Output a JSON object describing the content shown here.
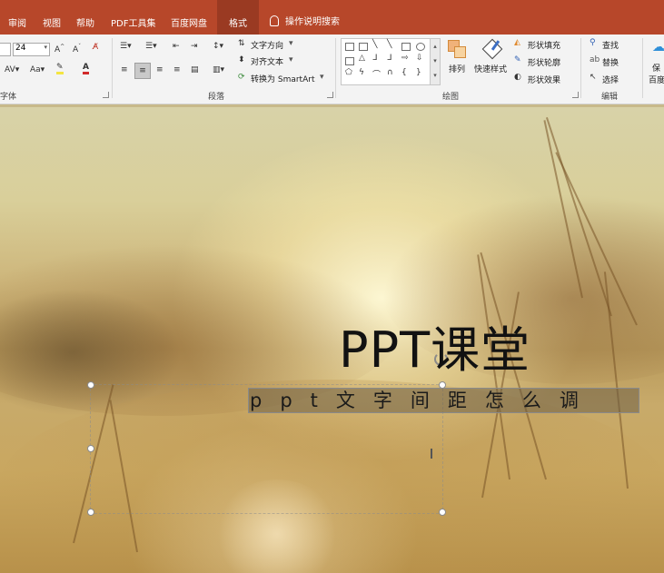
{
  "tabs": [
    {
      "label": "审阅",
      "active": false
    },
    {
      "label": "视图",
      "active": false
    },
    {
      "label": "帮助",
      "active": false
    },
    {
      "label": "PDF工具集",
      "active": false
    },
    {
      "label": "百度网盘",
      "active": false
    },
    {
      "label": "格式",
      "active": true
    }
  ],
  "tell_me": "操作说明搜索",
  "font_group": {
    "font_size": "24",
    "label": "字体"
  },
  "paragraph_group": {
    "label": "段落",
    "text_direction": "文字方向",
    "align_text": "对齐文本",
    "convert_smartart": "转换为 SmartArt"
  },
  "drawing_group": {
    "label": "绘图",
    "arrange": "排列",
    "quick_styles": "快速样式",
    "shape_fill": "形状填充",
    "shape_outline": "形状轮廓",
    "shape_effects": "形状效果"
  },
  "editing_group": {
    "label": "编辑",
    "find": "查找",
    "replace": "替换",
    "select": "选择"
  },
  "save_group": {
    "label_line1": "保",
    "label_line2": "百度"
  },
  "slide": {
    "title": "PPT课堂",
    "subtitle": "ppt文字间距怎么调"
  },
  "colors": {
    "accent": "#b7472a",
    "active_tab": "#9a3a22",
    "ribbon_bg": "#f3f3f3"
  }
}
